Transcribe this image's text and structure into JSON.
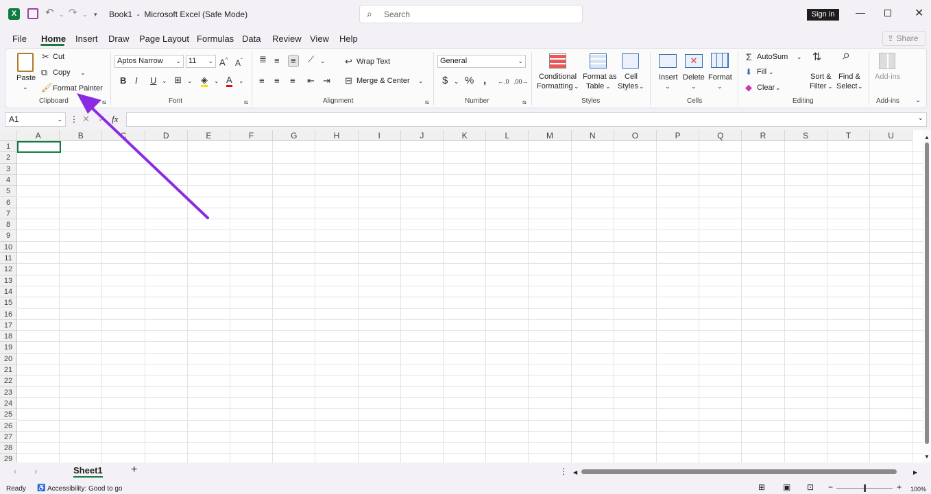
{
  "titlebar": {
    "title": "Book1  -  Microsoft Excel (Safe Mode)",
    "search_placeholder": "Search",
    "signin_label": "Sign in"
  },
  "menu": {
    "items": [
      "File",
      "Home",
      "Insert",
      "Draw",
      "Page Layout",
      "Formulas",
      "Data",
      "Review",
      "View",
      "Help"
    ],
    "active": "Home",
    "share_label": "Share"
  },
  "ribbon": {
    "clipboard": {
      "paste": "Paste",
      "cut": "Cut",
      "copy": "Copy",
      "format_painter": "Format Painter",
      "group": "Clipboard"
    },
    "font": {
      "font_name": "Aptos Narrow",
      "font_size": "11",
      "group": "Font"
    },
    "alignment": {
      "wrap_text": "Wrap Text",
      "merge_center": "Merge & Center",
      "group": "Alignment"
    },
    "number": {
      "format": "General",
      "group": "Number"
    },
    "styles": {
      "conditional_1": "Conditional",
      "conditional_2": "Formatting",
      "format_table_1": "Format as",
      "format_table_2": "Table",
      "cell_styles_1": "Cell",
      "cell_styles_2": "Styles",
      "group": "Styles"
    },
    "cells": {
      "insert": "Insert",
      "delete": "Delete",
      "format": "Format",
      "group": "Cells"
    },
    "editing": {
      "autosum": "AutoSum",
      "fill": "Fill",
      "clear": "Clear",
      "sort_1": "Sort &",
      "sort_2": "Filter",
      "find_1": "Find &",
      "find_2": "Select",
      "group": "Editing"
    },
    "addins": {
      "label": "Add-ins",
      "group": "Add-ins"
    }
  },
  "formula_bar": {
    "name_box": "A1",
    "fx": "fx",
    "value": ""
  },
  "grid": {
    "columns": [
      "A",
      "B",
      "C",
      "D",
      "E",
      "F",
      "G",
      "H",
      "I",
      "J",
      "K",
      "L",
      "M",
      "N",
      "O",
      "P",
      "Q",
      "R",
      "S",
      "T",
      "U"
    ],
    "rows": [
      "1",
      "2",
      "3",
      "4",
      "5",
      "6",
      "7",
      "8",
      "9",
      "10",
      "11",
      "12",
      "13",
      "14",
      "15",
      "16",
      "17",
      "18",
      "19",
      "20",
      "21",
      "22",
      "23",
      "24",
      "25",
      "26",
      "27",
      "28",
      "29"
    ]
  },
  "sheets": {
    "tabs": [
      "Sheet1"
    ],
    "add": "+"
  },
  "status": {
    "ready": "Ready",
    "accessibility": "Accessibility: Good to go",
    "zoom": "100%"
  },
  "colors": {
    "excel_green": "#107c41",
    "annotation_arrow": "#8a2be2"
  }
}
